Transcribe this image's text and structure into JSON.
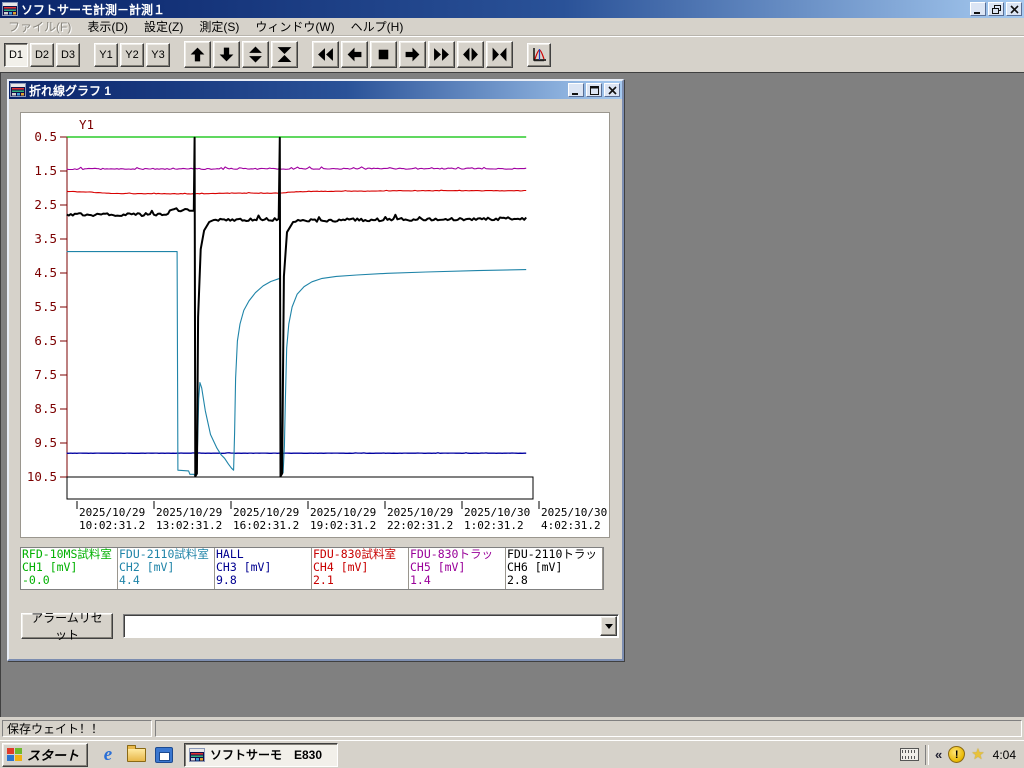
{
  "app": {
    "title": "ソフトサーモ計測－計測１"
  },
  "menu": {
    "items": [
      {
        "label": "ファイル(F)",
        "disabled": true
      },
      {
        "label": "表示(D)",
        "disabled": false
      },
      {
        "label": "設定(Z)",
        "disabled": false
      },
      {
        "label": "測定(S)",
        "disabled": false
      },
      {
        "label": "ウィンドウ(W)",
        "disabled": false
      },
      {
        "label": "ヘルプ(H)",
        "disabled": false
      }
    ]
  },
  "toolbar": {
    "text_buttons": [
      {
        "label": "D1",
        "pressed": true
      },
      {
        "label": "D2",
        "pressed": false
      },
      {
        "label": "D3",
        "pressed": false
      },
      {
        "label": "Y1",
        "pressed": false
      },
      {
        "label": "Y2",
        "pressed": false
      },
      {
        "label": "Y3",
        "pressed": false
      }
    ]
  },
  "graph_window": {
    "title": "折れ線グラフ 1"
  },
  "chart_data": {
    "type": "line",
    "y_axis_name": "Y1",
    "y_unit": "mV",
    "y_ticks": [
      0.5,
      1.5,
      2.5,
      3.5,
      4.5,
      5.5,
      6.5,
      7.5,
      8.5,
      9.5,
      10.5
    ],
    "y_inverted": true,
    "x_hours_per_tick": 3,
    "x_ticks": [
      {
        "date": "2025/10/29",
        "time": "10:02:31.2"
      },
      {
        "date": "2025/10/29",
        "time": "13:02:31.2"
      },
      {
        "date": "2025/10/29",
        "time": "16:02:31.2"
      },
      {
        "date": "2025/10/29",
        "time": "19:02:31.2"
      },
      {
        "date": "2025/10/29",
        "time": "22:02:31.2"
      },
      {
        "date": "2025/10/30",
        "time": "1:02:31.2"
      },
      {
        "date": "2025/10/30",
        "time": "4:02:31.2"
      }
    ],
    "series": [
      {
        "name": "CH1",
        "label": "RFD-10MS試料室",
        "color": "#00c000",
        "noise": 0,
        "points": [
          [
            -0.4,
            0.5
          ],
          [
            17.5,
            0.5
          ]
        ]
      },
      {
        "name": "CH5",
        "label": "FDU-830トラッ",
        "color": "#a000a0",
        "noise": 0.018,
        "points": [
          [
            -0.4,
            1.44
          ],
          [
            17.5,
            1.43
          ]
        ]
      },
      {
        "name": "CH4",
        "label": "FDU-830試料室",
        "color": "#d80000",
        "noise": 0.006,
        "points": [
          [
            -0.4,
            2.1
          ],
          [
            0.5,
            2.12
          ],
          [
            1.4,
            2.16
          ],
          [
            2.6,
            2.17
          ],
          [
            4.6,
            2.17
          ],
          [
            5.3,
            2.16
          ],
          [
            6.6,
            2.15
          ],
          [
            7.9,
            2.15
          ],
          [
            8.3,
            2.12
          ],
          [
            9.2,
            2.1
          ],
          [
            11.4,
            2.09
          ],
          [
            12.3,
            2.08
          ],
          [
            17.5,
            2.08
          ]
        ]
      },
      {
        "name": "CH3",
        "label": "HALL",
        "color": "#0000a0",
        "noise": 0.004,
        "points": [
          [
            -0.4,
            9.8
          ],
          [
            17.5,
            9.8
          ]
        ]
      },
      {
        "name": "CH2",
        "label": "FDU-2110試料室",
        "color": "#1f84a8",
        "noise": 0,
        "points": [
          [
            -0.4,
            3.87
          ],
          [
            3.9,
            3.87
          ],
          [
            3.93,
            10.3
          ],
          [
            4.35,
            10.32
          ],
          [
            4.4,
            10.42
          ],
          [
            4.56,
            10.42
          ],
          [
            4.6,
            10.48
          ],
          [
            4.66,
            10.44
          ],
          [
            4.7,
            9.5
          ],
          [
            4.74,
            8.2
          ],
          [
            4.79,
            7.72
          ],
          [
            4.86,
            7.88
          ],
          [
            5.0,
            8.55
          ],
          [
            5.2,
            9.25
          ],
          [
            5.45,
            9.65
          ],
          [
            5.62,
            9.85
          ],
          [
            5.75,
            9.95
          ],
          [
            5.9,
            10.12
          ],
          [
            6.02,
            10.24
          ],
          [
            6.1,
            10.3
          ],
          [
            6.14,
            9.2
          ],
          [
            6.18,
            7.6
          ],
          [
            6.25,
            6.5
          ],
          [
            6.35,
            6.0
          ],
          [
            6.5,
            5.6
          ],
          [
            6.7,
            5.32
          ],
          [
            6.95,
            5.08
          ],
          [
            7.25,
            4.88
          ],
          [
            7.55,
            4.75
          ],
          [
            7.85,
            4.67
          ],
          [
            7.91,
            4.66
          ],
          [
            7.95,
            10.33
          ],
          [
            8.03,
            10.38
          ],
          [
            8.08,
            9.6
          ],
          [
            8.12,
            8.2
          ],
          [
            8.17,
            6.7
          ],
          [
            8.25,
            6.0
          ],
          [
            8.38,
            5.5
          ],
          [
            8.58,
            5.12
          ],
          [
            8.85,
            4.9
          ],
          [
            9.15,
            4.76
          ],
          [
            9.55,
            4.66
          ],
          [
            10.1,
            4.6
          ],
          [
            10.9,
            4.56
          ],
          [
            12.1,
            4.51
          ],
          [
            13.6,
            4.47
          ],
          [
            15.6,
            4.43
          ],
          [
            17.5,
            4.4
          ]
        ]
      },
      {
        "name": "CH6",
        "label": "FDU-2110トラッ",
        "color": "#000000",
        "noise": 0.045,
        "points": [
          [
            -0.4,
            2.78
          ],
          [
            3.55,
            2.78
          ],
          [
            3.62,
            2.66
          ],
          [
            4.55,
            2.66
          ],
          [
            4.58,
            0.52
          ],
          [
            4.61,
            10.48
          ],
          [
            4.67,
            10.4
          ],
          [
            4.72,
            5.8
          ],
          [
            4.82,
            3.8
          ],
          [
            4.95,
            3.25
          ],
          [
            5.15,
            3.0
          ],
          [
            5.5,
            2.93
          ],
          [
            7.86,
            2.93
          ],
          [
            7.9,
            0.52
          ],
          [
            7.93,
            10.48
          ],
          [
            7.99,
            10.4
          ],
          [
            8.06,
            4.6
          ],
          [
            8.18,
            3.3
          ],
          [
            8.42,
            3.0
          ],
          [
            8.8,
            2.95
          ],
          [
            17.5,
            2.9
          ]
        ]
      }
    ]
  },
  "legend": {
    "channels": [
      {
        "name": "RFD-10MS試料室",
        "ch": "CH1 [mV]",
        "value": "-0.0",
        "color": "#00b000"
      },
      {
        "name": "FDU-2110試料室",
        "ch": "CH2 [mV]",
        "value": "4.4",
        "color": "#1f84a8"
      },
      {
        "name": "HALL",
        "ch": "CH3 [mV]",
        "value": "9.8",
        "color": "#000090"
      },
      {
        "name": "FDU-830試料室",
        "ch": "CH4 [mV]",
        "value": "2.1",
        "color": "#c80000"
      },
      {
        "name": "FDU-830トラッ",
        "ch": "CH5 [mV]",
        "value": "1.4",
        "color": "#990099"
      },
      {
        "name": "FDU-2110トラッ",
        "ch": "CH6 [mV]",
        "value": "2.8",
        "color": "#000000"
      }
    ]
  },
  "alarm": {
    "reset_label": "アラームリセット",
    "combo_value": ""
  },
  "status_bar": {
    "message": "保存ウェイト！！"
  },
  "taskbar": {
    "start_label": "スタート",
    "task_button": "ソフトサーモ　E830",
    "clock": "4:04"
  }
}
